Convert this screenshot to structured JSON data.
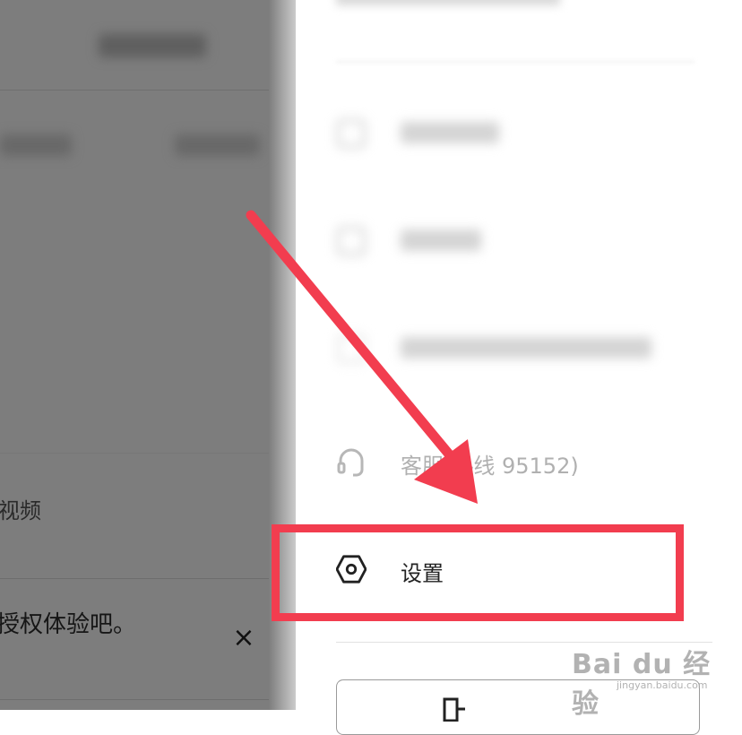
{
  "left_page": {
    "video_label": "视频",
    "auth_prompt": "授权体验吧。",
    "close_symbol": "×"
  },
  "drawer": {
    "menu": [
      {
        "label": "",
        "icon": "blurred-icon"
      },
      {
        "label": "",
        "icon": "blurred-icon"
      },
      {
        "label": "",
        "icon": "blurred-icon"
      },
      {
        "label": "客服(热线 95152)",
        "icon": "headset-icon"
      },
      {
        "label": "设置",
        "icon": "settings-hexagon-icon"
      }
    ],
    "bottom_button": {
      "label": "",
      "icon": "door-icon"
    }
  },
  "annotations": {
    "arrow_color": "#f23d4f",
    "box_color": "#f23d4f"
  },
  "watermark": {
    "main": "Bai du 经验",
    "sub": "jingyan.baidu.com"
  }
}
